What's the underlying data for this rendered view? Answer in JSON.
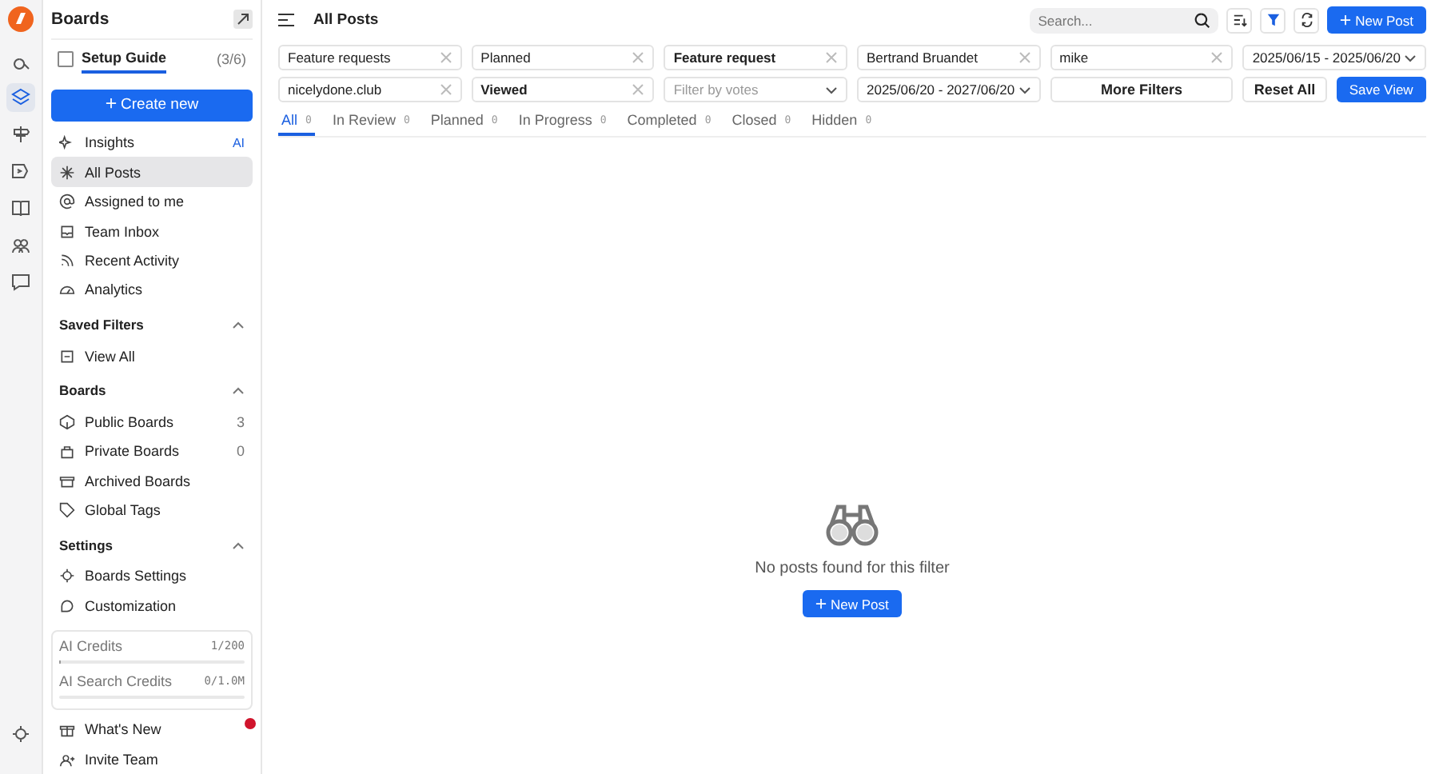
{
  "rail": {
    "items": [
      {
        "selected": false
      },
      {
        "selected": true
      },
      {
        "selected": false
      },
      {
        "selected": false
      },
      {
        "selected": false
      },
      {
        "selected": false
      },
      {
        "selected": false
      }
    ]
  },
  "sidebar": {
    "title": "Boards",
    "setup_guide": {
      "label": "Setup Guide",
      "progress": "(3/6)",
      "checked": false
    },
    "create_button": "Create new",
    "items": [
      {
        "label": "Insights",
        "badge": "AI",
        "selected": false
      },
      {
        "label": "All Posts",
        "selected": true
      },
      {
        "label": "Assigned to me",
        "selected": false
      },
      {
        "label": "Team Inbox",
        "selected": false
      },
      {
        "label": "Recent Activity",
        "selected": false
      },
      {
        "label": "Analytics",
        "selected": false
      }
    ],
    "sections": [
      {
        "title": "Saved Filters",
        "expanded": true,
        "items": [
          {
            "label": "View All"
          }
        ]
      },
      {
        "title": "Boards",
        "expanded": true,
        "items": [
          {
            "label": "Public Boards",
            "count": "3"
          },
          {
            "label": "Private Boards",
            "count": "0"
          },
          {
            "label": "Archived Boards"
          },
          {
            "label": "Global Tags"
          }
        ]
      },
      {
        "title": "Settings",
        "expanded": true,
        "items": [
          {
            "label": "Boards Settings"
          },
          {
            "label": "Customization"
          }
        ]
      }
    ],
    "credits": [
      {
        "label": "AI Credits",
        "value": "1/200",
        "level": 0.005
      },
      {
        "label": "AI Search Credits",
        "value": "0/1.0M",
        "level": 0
      }
    ],
    "footer": [
      {
        "label": "What's New",
        "notification": true
      },
      {
        "label": "Invite Team",
        "notification": false
      }
    ]
  },
  "header": {
    "title": "All Posts",
    "search": {
      "placeholder": "Search..."
    },
    "new_post": "New Post"
  },
  "filters": [
    {
      "kind": "clearable",
      "value": "Feature requests",
      "emphasis": false
    },
    {
      "kind": "clearable",
      "value": "Planned",
      "emphasis": false
    },
    {
      "kind": "clearable",
      "value": "Feature request",
      "emphasis": true
    },
    {
      "kind": "clearable",
      "value": "Bertrand Bruandet",
      "emphasis": false
    },
    {
      "kind": "clearable",
      "value": "mike",
      "emphasis": false
    },
    {
      "kind": "dropdown",
      "value": "2025/06/15 - 2025/06/20"
    },
    {
      "kind": "clearable",
      "value": "nicelydone.club",
      "emphasis": false
    },
    {
      "kind": "clearable",
      "value": "Viewed",
      "emphasis": true
    },
    {
      "kind": "dropdown",
      "placeholder": "Filter by votes"
    },
    {
      "kind": "dropdown",
      "value": "2025/06/20 - 2027/06/20"
    },
    {
      "kind": "button",
      "value": "More Filters"
    },
    {
      "kind": "split",
      "value": "Reset All",
      "primary": "Save View"
    }
  ],
  "tabs": [
    {
      "label": "All",
      "count": "0",
      "selected": true
    },
    {
      "label": "In Review",
      "count": "0",
      "selected": false
    },
    {
      "label": "Planned",
      "count": "0",
      "selected": false
    },
    {
      "label": "In Progress",
      "count": "0",
      "selected": false
    },
    {
      "label": "Completed",
      "count": "0",
      "selected": false
    },
    {
      "label": "Closed",
      "count": "0",
      "selected": false
    },
    {
      "label": "Hidden",
      "count": "0",
      "selected": false
    }
  ],
  "empty_state": {
    "message": "No posts found for this filter",
    "button": "New Post"
  }
}
